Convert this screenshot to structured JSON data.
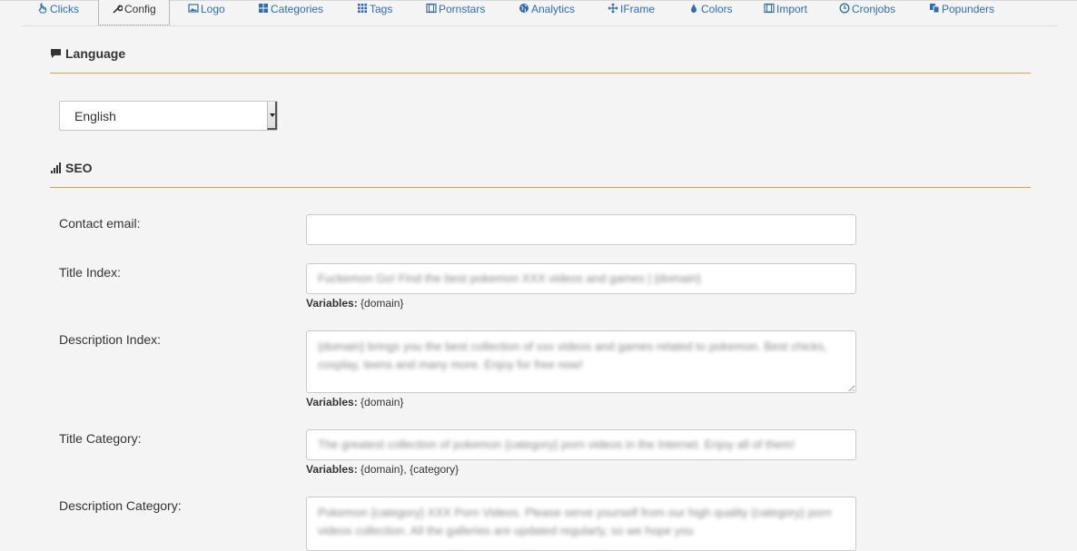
{
  "tabs": [
    {
      "label": "Clicks",
      "icon": "pointer-hand-icon",
      "active": false
    },
    {
      "label": "Config",
      "icon": "wrench-icon",
      "active": true
    },
    {
      "label": "Logo",
      "icon": "image-icon",
      "active": false
    },
    {
      "label": "Categories",
      "icon": "grid-icon",
      "active": false
    },
    {
      "label": "Tags",
      "icon": "dots-grid-icon",
      "active": false
    },
    {
      "label": "Pornstars",
      "icon": "film-icon",
      "active": false
    },
    {
      "label": "Analytics",
      "icon": "globe-icon",
      "active": false
    },
    {
      "label": "IFrame",
      "icon": "move-icon",
      "active": false
    },
    {
      "label": "Colors",
      "icon": "drop-icon",
      "active": false
    },
    {
      "label": "Import",
      "icon": "film-icon",
      "active": false
    },
    {
      "label": "Cronjobs",
      "icon": "clock-icon",
      "active": false
    },
    {
      "label": "Popunders",
      "icon": "copy-icon",
      "active": false
    }
  ],
  "language": {
    "title": "Language",
    "icon": "comment-icon",
    "selected": "English"
  },
  "seo": {
    "title": "SEO",
    "icon": "signal-bars-icon",
    "fields": {
      "contact_email": {
        "label": "Contact email:",
        "value": ""
      },
      "title_index": {
        "label": "Title Index:",
        "value": "Fuckemon Go! Find the best pokemon XXX videos and games | {domain}",
        "variables_label": "Variables:",
        "variables": "{domain}"
      },
      "description_index": {
        "label": "Description Index:",
        "value": "{domain} brings you the best collection of xxx videos and games related to pokemon. Best chicks, cosplay, teens and many more. Enjoy for free now!",
        "variables_label": "Variables:",
        "variables": "{domain}"
      },
      "title_category": {
        "label": "Title Category:",
        "value": "The greatest collection of pokemon {category} porn videos in the Internet. Enjoy all of them!",
        "variables_label": "Variables:",
        "variables": "{domain}, {category}"
      },
      "description_category": {
        "label": "Description Category:",
        "value": "Pokemon {category} XXX Porn Videos. Please serve yourself from our high quality {category} porn videos collection. All the galleries are updated regularly, so we hope you"
      }
    }
  },
  "colors": {
    "link": "#2a6ebb",
    "accent_rule": "#e0a03c",
    "background": "#f4f4f4"
  }
}
